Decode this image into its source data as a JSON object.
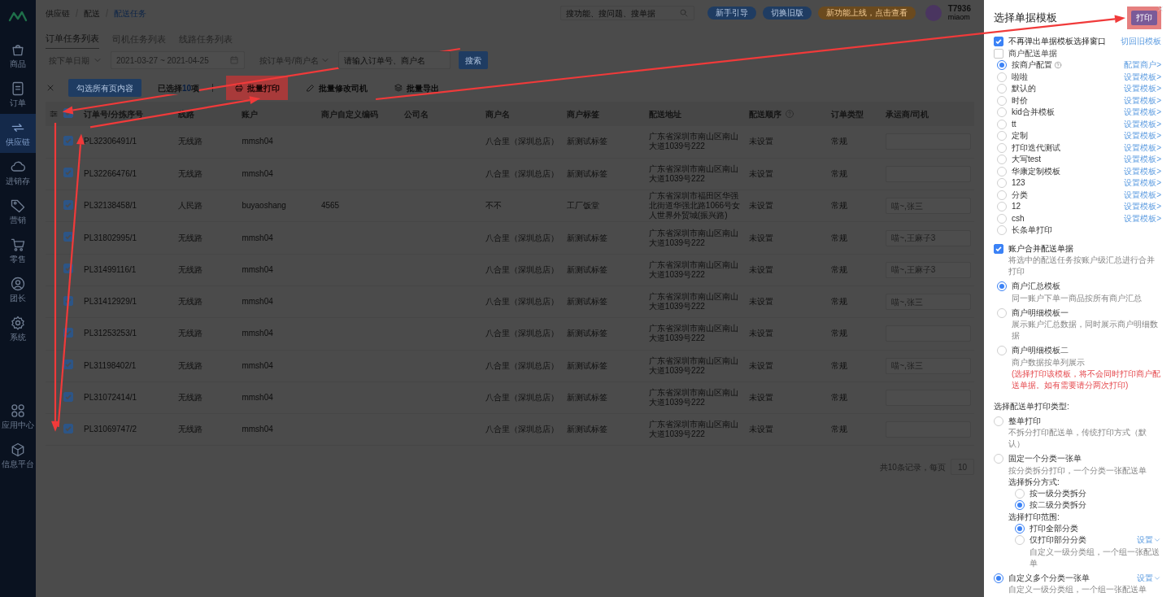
{
  "sidebar": {
    "items": [
      {
        "label": "商品",
        "selected": false
      },
      {
        "label": "订单",
        "selected": false
      },
      {
        "label": "供应链",
        "selected": true
      },
      {
        "label": "进销存",
        "selected": false
      },
      {
        "label": "营销",
        "selected": false
      },
      {
        "label": "零售",
        "selected": false
      },
      {
        "label": "团长",
        "selected": false
      },
      {
        "label": "系统",
        "selected": false
      }
    ],
    "bottom_items": [
      {
        "label": "应用中心"
      },
      {
        "label": "信息平台"
      }
    ]
  },
  "header": {
    "breadcrumb": [
      "供应链",
      "配送",
      "配送任务"
    ],
    "search_placeholder": "搜功能、搜问题、搜单据",
    "buttons": [
      {
        "label": "新手引导",
        "kind": "primary"
      },
      {
        "label": "切换旧版",
        "kind": "primary"
      },
      {
        "label": "新功能上线，点击查看",
        "kind": "warning"
      }
    ],
    "user": {
      "name": "T7936",
      "account": "miaom"
    }
  },
  "tabs": [
    {
      "label": "订单任务列表",
      "selected": true
    },
    {
      "label": "司机任务列表",
      "selected": false
    },
    {
      "label": "线路任务列表",
      "selected": false
    }
  ],
  "filters": {
    "date_type": "按下单日期",
    "date_range": "2021-03-27 ~ 2021-04-25",
    "search_type": "按订单号/商户名",
    "search_placeholder": "请输入订单号、商户名",
    "search_button": "搜索"
  },
  "toolbar": {
    "select_all_button": "勾选所有页内容",
    "selected_prefix": "已选择",
    "selected_count": "10",
    "selected_suffix": "项",
    "actions": [
      {
        "label": "批量打印",
        "kind": "print",
        "highlighted": true
      },
      {
        "label": "批量修改司机",
        "kind": "edit",
        "highlighted": false
      },
      {
        "label": "批量导出",
        "kind": "export",
        "highlighted": false
      }
    ]
  },
  "table": {
    "all_checked": true,
    "columns": [
      {
        "label": "订单号/分拣序号"
      },
      {
        "label": "线路"
      },
      {
        "label": "账户"
      },
      {
        "label": "商户自定义编码"
      },
      {
        "label": "公司名"
      },
      {
        "label": "商户名"
      },
      {
        "label": "商户标签"
      },
      {
        "label": "配送地址"
      },
      {
        "label": "配送顺序",
        "hint_icon": true
      },
      {
        "label": "订单类型"
      },
      {
        "label": "承运商/司机"
      }
    ],
    "rows": [
      {
        "checked": true,
        "order": "PL32306491/1",
        "route": "无线路",
        "account": "mmsh04",
        "merchant": "八合里（深圳总店）",
        "tag": "新测试标签",
        "address": "广东省深圳市南山区南山大道1039号222",
        "sequence": "未设置",
        "type": "常规"
      },
      {
        "checked": true,
        "order": "PL32266476/1",
        "route": "无线路",
        "account": "mmsh04",
        "merchant": "八合里（深圳总店）",
        "tag": "新测试标签",
        "address": "广东省深圳市南山区南山大道1039号222",
        "sequence": "未设置",
        "type": "常规"
      },
      {
        "checked": true,
        "order": "PL32138458/1",
        "route": "人民路",
        "account": "buyaoshang",
        "code": "4565",
        "merchant": "不不",
        "tag": "工厂饭堂",
        "address": "广东省深圳市福田区华强北街道华强北路1066号女人世界外贸城(振兴路)",
        "sequence": "未设置",
        "type": "常规",
        "driver": "喵~,张三"
      },
      {
        "checked": true,
        "order": "PL31802995/1",
        "route": "无线路",
        "account": "mmsh04",
        "merchant": "八合里（深圳总店）",
        "tag": "新测试标签",
        "address": "广东省深圳市南山区南山大道1039号222",
        "sequence": "未设置",
        "type": "常规",
        "driver": "喵~,王麻子3"
      },
      {
        "checked": true,
        "order": "PL31499116/1",
        "route": "无线路",
        "account": "mmsh04",
        "merchant": "八合里（深圳总店）",
        "tag": "新测试标签",
        "address": "广东省深圳市南山区南山大道1039号222",
        "sequence": "未设置",
        "type": "常规",
        "driver": "喵~,王麻子3"
      },
      {
        "checked": true,
        "order": "PL31412929/1",
        "route": "无线路",
        "account": "mmsh04",
        "merchant": "八合里（深圳总店）",
        "tag": "新测试标签",
        "address": "广东省深圳市南山区南山大道1039号222",
        "sequence": "未设置",
        "type": "常规",
        "driver": "喵~,张三"
      },
      {
        "checked": true,
        "order": "PL31253253/1",
        "route": "无线路",
        "account": "mmsh04",
        "merchant": "八合里（深圳总店）",
        "tag": "新测试标签",
        "address": "广东省深圳市南山区南山大道1039号222",
        "sequence": "未设置",
        "type": "常规"
      },
      {
        "checked": true,
        "order": "PL31198402/1",
        "route": "无线路",
        "account": "mmsh04",
        "merchant": "八合里（深圳总店）",
        "tag": "新测试标签",
        "address": "广东省深圳市南山区南山大道1039号222",
        "sequence": "未设置",
        "type": "常规",
        "driver": "喵~,张三"
      },
      {
        "checked": true,
        "order": "PL31072414/1",
        "route": "无线路",
        "account": "mmsh04",
        "merchant": "八合里（深圳总店）",
        "tag": "新测试标签",
        "address": "广东省深圳市南山区南山大道1039号222",
        "sequence": "未设置",
        "type": "常规"
      },
      {
        "checked": true,
        "order": "PL31069747/2",
        "route": "无线路",
        "account": "mmsh04",
        "merchant": "八合里（深圳总店）",
        "tag": "新测试标签",
        "address": "广东省深圳市南山区南山大道1039号222",
        "sequence": "未设置",
        "type": "常规"
      }
    ]
  },
  "pagination": {
    "summary": "共10条记录，每页",
    "page_size": "10"
  },
  "panel": {
    "title": "选择单据模板",
    "print_button": "打印",
    "print_highlighted": true,
    "no_popup": {
      "label": "不再弹出单据模板选择窗口",
      "checked": true
    },
    "switch_link": "切回旧模板",
    "merchant_doc": {
      "label": "商户配送单据",
      "checked": false
    },
    "templates": [
      {
        "label": "按商户配置",
        "selected": true,
        "hint_icon": true,
        "link": "配置商户>"
      },
      {
        "label": "啦啦",
        "selected": false,
        "link": "设置模板>"
      },
      {
        "label": "默认的",
        "selected": false,
        "link": "设置模板>"
      },
      {
        "label": "时价",
        "selected": false,
        "link": "设置模板>"
      },
      {
        "label": "kid合并模板",
        "selected": false,
        "link": "设置模板>"
      },
      {
        "label": "tt",
        "selected": false,
        "link": "设置模板>"
      },
      {
        "label": "定制",
        "selected": false,
        "link": "设置模板>"
      },
      {
        "label": "打印迭代测试",
        "selected": false,
        "link": "设置模板>"
      },
      {
        "label": "大写test",
        "selected": false,
        "link": "设置模板>"
      },
      {
        "label": "华康定制模板",
        "selected": false,
        "link": "设置模板>"
      },
      {
        "label": "123",
        "selected": false,
        "link": "设置模板>"
      },
      {
        "label": "分类",
        "selected": false,
        "link": "设置模板>"
      },
      {
        "label": "12",
        "selected": false,
        "link": "设置模板>"
      },
      {
        "label": "csh",
        "selected": false,
        "link": "设置模板>"
      },
      {
        "label": "长条单打印",
        "selected": false
      }
    ],
    "account_merge": {
      "label": "账户合并配送单据",
      "checked": true,
      "description": "将选中的配送任务按账户级汇总进行合并打印"
    },
    "account_templates": [
      {
        "label": "商户汇总模板",
        "selected": true,
        "description": "同一账户下单一商品按所有商户汇总"
      },
      {
        "label": "商户明细模板一",
        "selected": false,
        "description": "展示账户汇总数据，同时展示商户明细数据"
      },
      {
        "label": "商户明细模板二",
        "selected": false,
        "description": "商户数据按单列展示",
        "warning": "(选择打印该模板，将不会同时打印商户配送单据。如有需要请分两次打印)"
      }
    ],
    "print_type": {
      "heading": "选择配送单打印类型:",
      "options": [
        {
          "label": "整单打印",
          "selected": false,
          "description": "不拆分打印配送单，传统打印方式（默认）"
        },
        {
          "label": "固定一个分类一张单",
          "selected": false,
          "description": "按分类拆分打印，一个分类一张配送单",
          "groups": [
            {
              "heading": "选择拆分方式:",
              "options": [
                {
                  "label": "按一级分类拆分",
                  "selected": false
                },
                {
                  "label": "按二级分类拆分",
                  "selected": true
                }
              ]
            },
            {
              "heading": "选择打印范围:",
              "options": [
                {
                  "label": "打印全部分类",
                  "selected": true
                },
                {
                  "label": "仅打印部分分类",
                  "selected": false,
                  "link": "设置",
                  "description": "自定义一级分类组，一个组一张配送单"
                }
              ]
            }
          ]
        },
        {
          "label": "自定义多个分类一张单",
          "selected": true,
          "link": "设置",
          "description": "自定义一级分类组，一个组一张配送单"
        }
      ]
    }
  }
}
